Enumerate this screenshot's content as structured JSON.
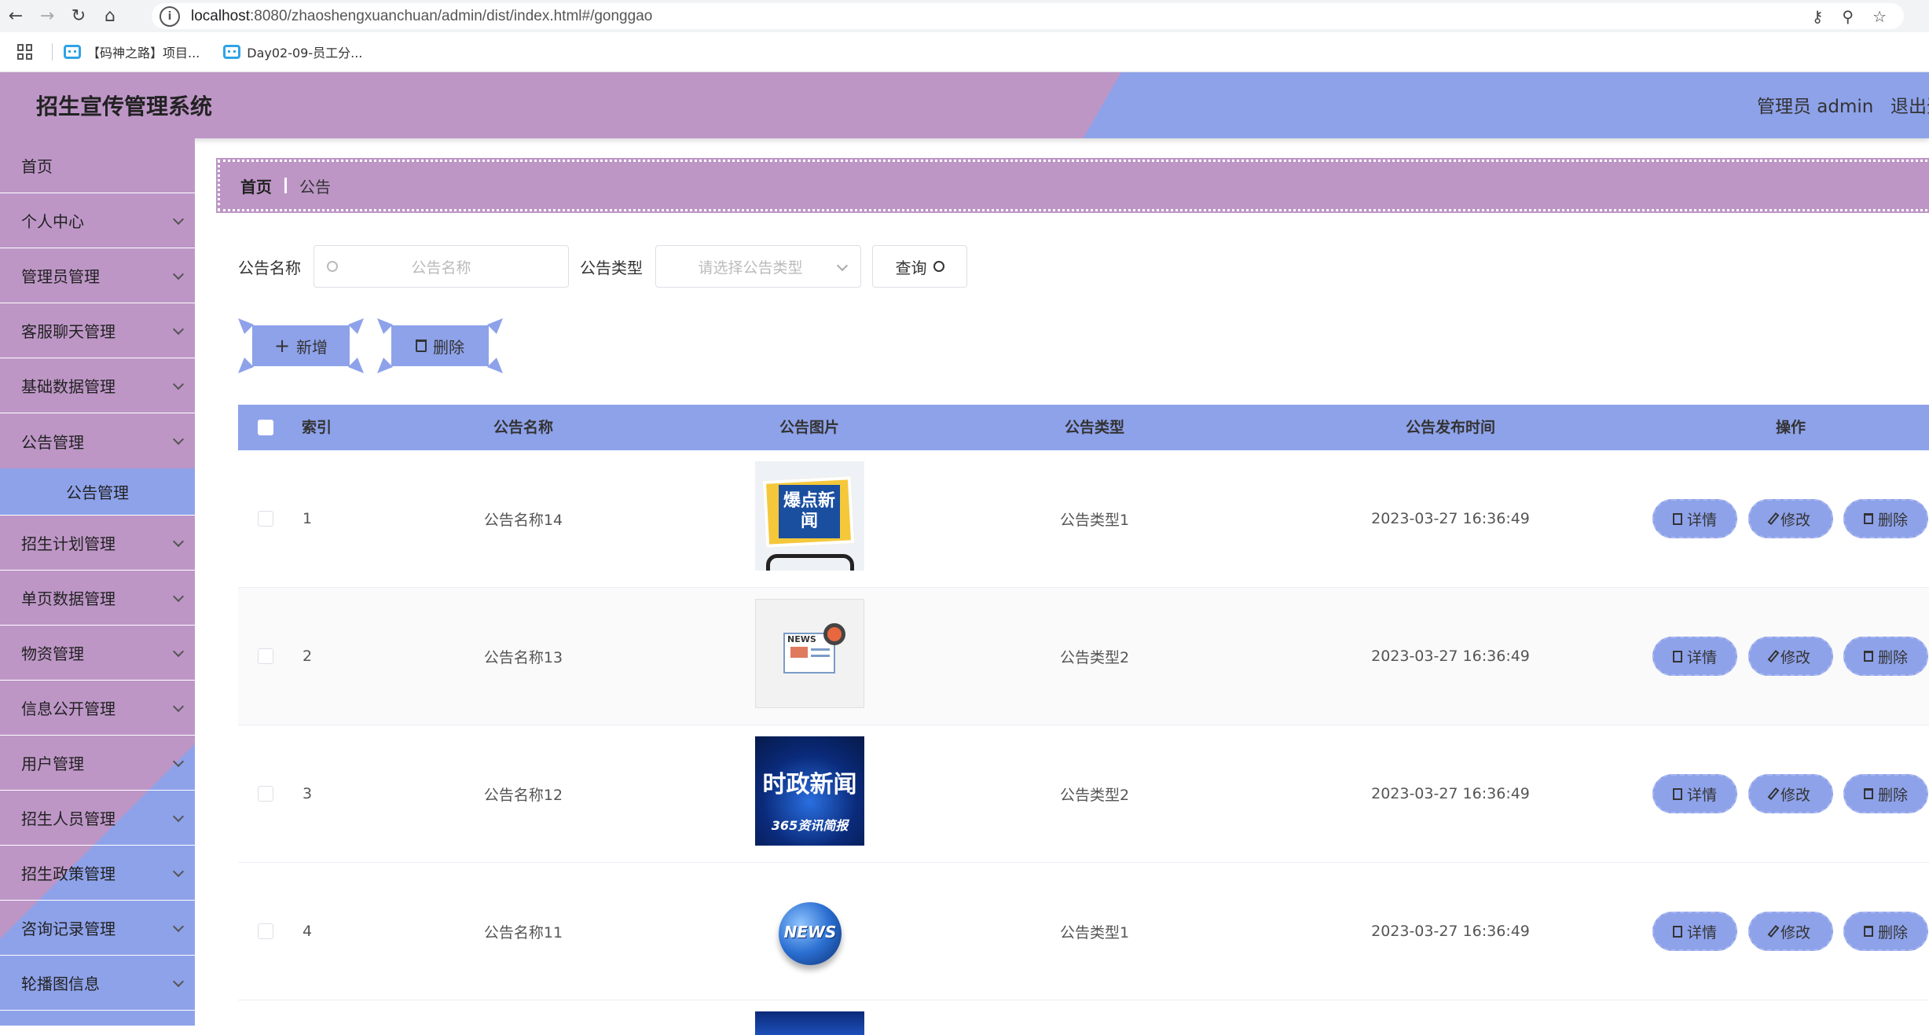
{
  "browser": {
    "url_host": "localhost",
    "url_rest": ":8080/zhaoshengxuanchuan/admin/dist/index.html#/gonggao",
    "bookmarks": [
      "【码神之路】项目...",
      "Day02-09-员工分..."
    ]
  },
  "header": {
    "title": "招生宣传管理系统",
    "user": "管理员 admin",
    "logout": "退出登录"
  },
  "colors": {
    "purple": "#bd96c6",
    "blue": "#8ea2ea"
  },
  "sidebar": {
    "items": [
      {
        "label": "首页",
        "has_arrow": false
      },
      {
        "label": "个人中心",
        "has_arrow": true
      },
      {
        "label": "管理员管理",
        "has_arrow": true
      },
      {
        "label": "客服聊天管理",
        "has_arrow": true
      },
      {
        "label": "基础数据管理",
        "has_arrow": true
      },
      {
        "label": "公告管理",
        "has_arrow": true,
        "sub": "公告管理"
      },
      {
        "label": "招生计划管理",
        "has_arrow": true
      },
      {
        "label": "单页数据管理",
        "has_arrow": true
      },
      {
        "label": "物资管理",
        "has_arrow": true
      },
      {
        "label": "信息公开管理",
        "has_arrow": true
      },
      {
        "label": "用户管理",
        "has_arrow": true
      },
      {
        "label": "招生人员管理",
        "has_arrow": true
      },
      {
        "label": "招生政策管理",
        "has_arrow": true
      },
      {
        "label": "咨询记录管理",
        "has_arrow": true
      },
      {
        "label": "轮播图信息",
        "has_arrow": true
      }
    ]
  },
  "breadcrumb": {
    "home": "首页",
    "current": "公告"
  },
  "search": {
    "name_label": "公告名称",
    "name_placeholder": "公告名称",
    "type_label": "公告类型",
    "type_placeholder": "请选择公告类型",
    "query_button": "查询"
  },
  "actions": {
    "add": "新增",
    "delete": "删除"
  },
  "table": {
    "headers": [
      "索引",
      "公告名称",
      "公告图片",
      "公告类型",
      "公告发布时间",
      "操作"
    ],
    "rows": [
      {
        "index": "1",
        "name": "公告名称14",
        "image": "爆点新闻",
        "type": "公告类型1",
        "time": "2023-03-27 16:36:49"
      },
      {
        "index": "2",
        "name": "公告名称13",
        "image": "NEWS",
        "type": "公告类型2",
        "time": "2023-03-27 16:36:49"
      },
      {
        "index": "3",
        "name": "公告名称12",
        "image": "时政新闻",
        "image_sub": "365资讯简报",
        "type": "公告类型2",
        "time": "2023-03-27 16:36:49"
      },
      {
        "index": "4",
        "name": "公告名称11",
        "image": "NEWS",
        "type": "公告类型1",
        "time": "2023-03-27 16:36:49"
      }
    ],
    "row_actions": [
      "详情",
      "修改",
      "删除"
    ]
  }
}
